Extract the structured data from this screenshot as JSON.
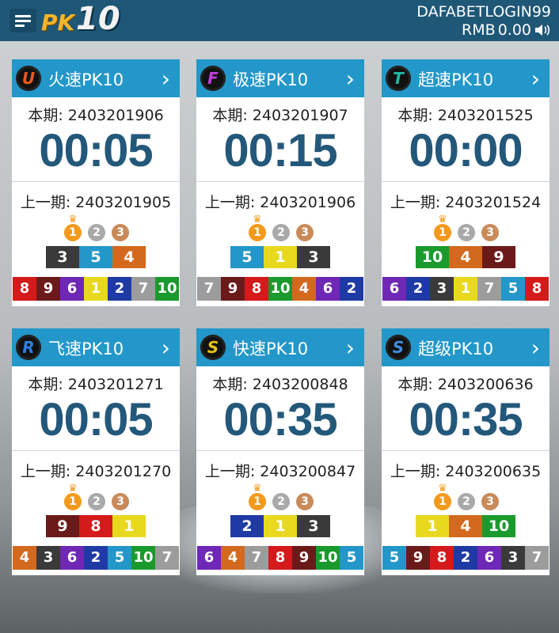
{
  "header": {
    "logo_pk": "PK",
    "logo_ten": "10",
    "username": "DAFABETLOGIN99",
    "currency": "RMB",
    "balance": "0.00"
  },
  "colors": {
    "1": "#e8d91f",
    "2": "#1f3aa5",
    "3": "#3a3a3a",
    "4": "#d3691e",
    "5": "#2397c9",
    "6": "#6f27b6",
    "7": "#9c9c9c",
    "8": "#d41a1a",
    "9": "#6b1a1a",
    "10": "#1a9a2d"
  },
  "cards": [
    {
      "name": "火速PK10",
      "badge": "U",
      "badge_color": "#e85a1a",
      "current_label": "本期: 2403201906",
      "timer": "00:05",
      "prev_label": "上一期: 2403201905",
      "top3": [
        "3",
        "5",
        "4"
      ],
      "rest": [
        "8",
        "9",
        "6",
        "1",
        "2",
        "7",
        "10"
      ]
    },
    {
      "name": "极速PK10",
      "badge": "F",
      "badge_color": "#c03fd8",
      "current_label": "本期: 2403201907",
      "timer": "00:15",
      "prev_label": "上一期: 2403201906",
      "top3": [
        "5",
        "1",
        "3"
      ],
      "rest": [
        "7",
        "9",
        "8",
        "10",
        "4",
        "6",
        "2"
      ]
    },
    {
      "name": "超速PK10",
      "badge": "T",
      "badge_color": "#1fb8a2",
      "current_label": "本期: 2403201525",
      "timer": "00:00",
      "prev_label": "上一期: 2403201524",
      "top3": [
        "10",
        "4",
        "9"
      ],
      "rest": [
        "6",
        "2",
        "3",
        "1",
        "7",
        "5",
        "8"
      ]
    },
    {
      "name": "飞速PK10",
      "badge": "R",
      "badge_color": "#2f7de1",
      "current_label": "本期: 2403201271",
      "timer": "00:05",
      "prev_label": "上一期: 2403201270",
      "top3": [
        "9",
        "8",
        "1"
      ],
      "rest": [
        "4",
        "3",
        "6",
        "2",
        "5",
        "10",
        "7"
      ]
    },
    {
      "name": "快速PK10",
      "badge": "S",
      "badge_color": "#e7c21a",
      "current_label": "本期: 2403200848",
      "timer": "00:35",
      "prev_label": "上一期: 2403200847",
      "top3": [
        "2",
        "1",
        "3"
      ],
      "rest": [
        "6",
        "4",
        "7",
        "8",
        "9",
        "10",
        "5"
      ]
    },
    {
      "name": "超级PK10",
      "badge": "S",
      "badge_color": "#3f8fe1",
      "current_label": "本期: 2403200636",
      "timer": "00:35",
      "prev_label": "上一期: 2403200635",
      "top3": [
        "1",
        "4",
        "10"
      ],
      "rest": [
        "5",
        "9",
        "8",
        "2",
        "6",
        "3",
        "7"
      ]
    }
  ]
}
